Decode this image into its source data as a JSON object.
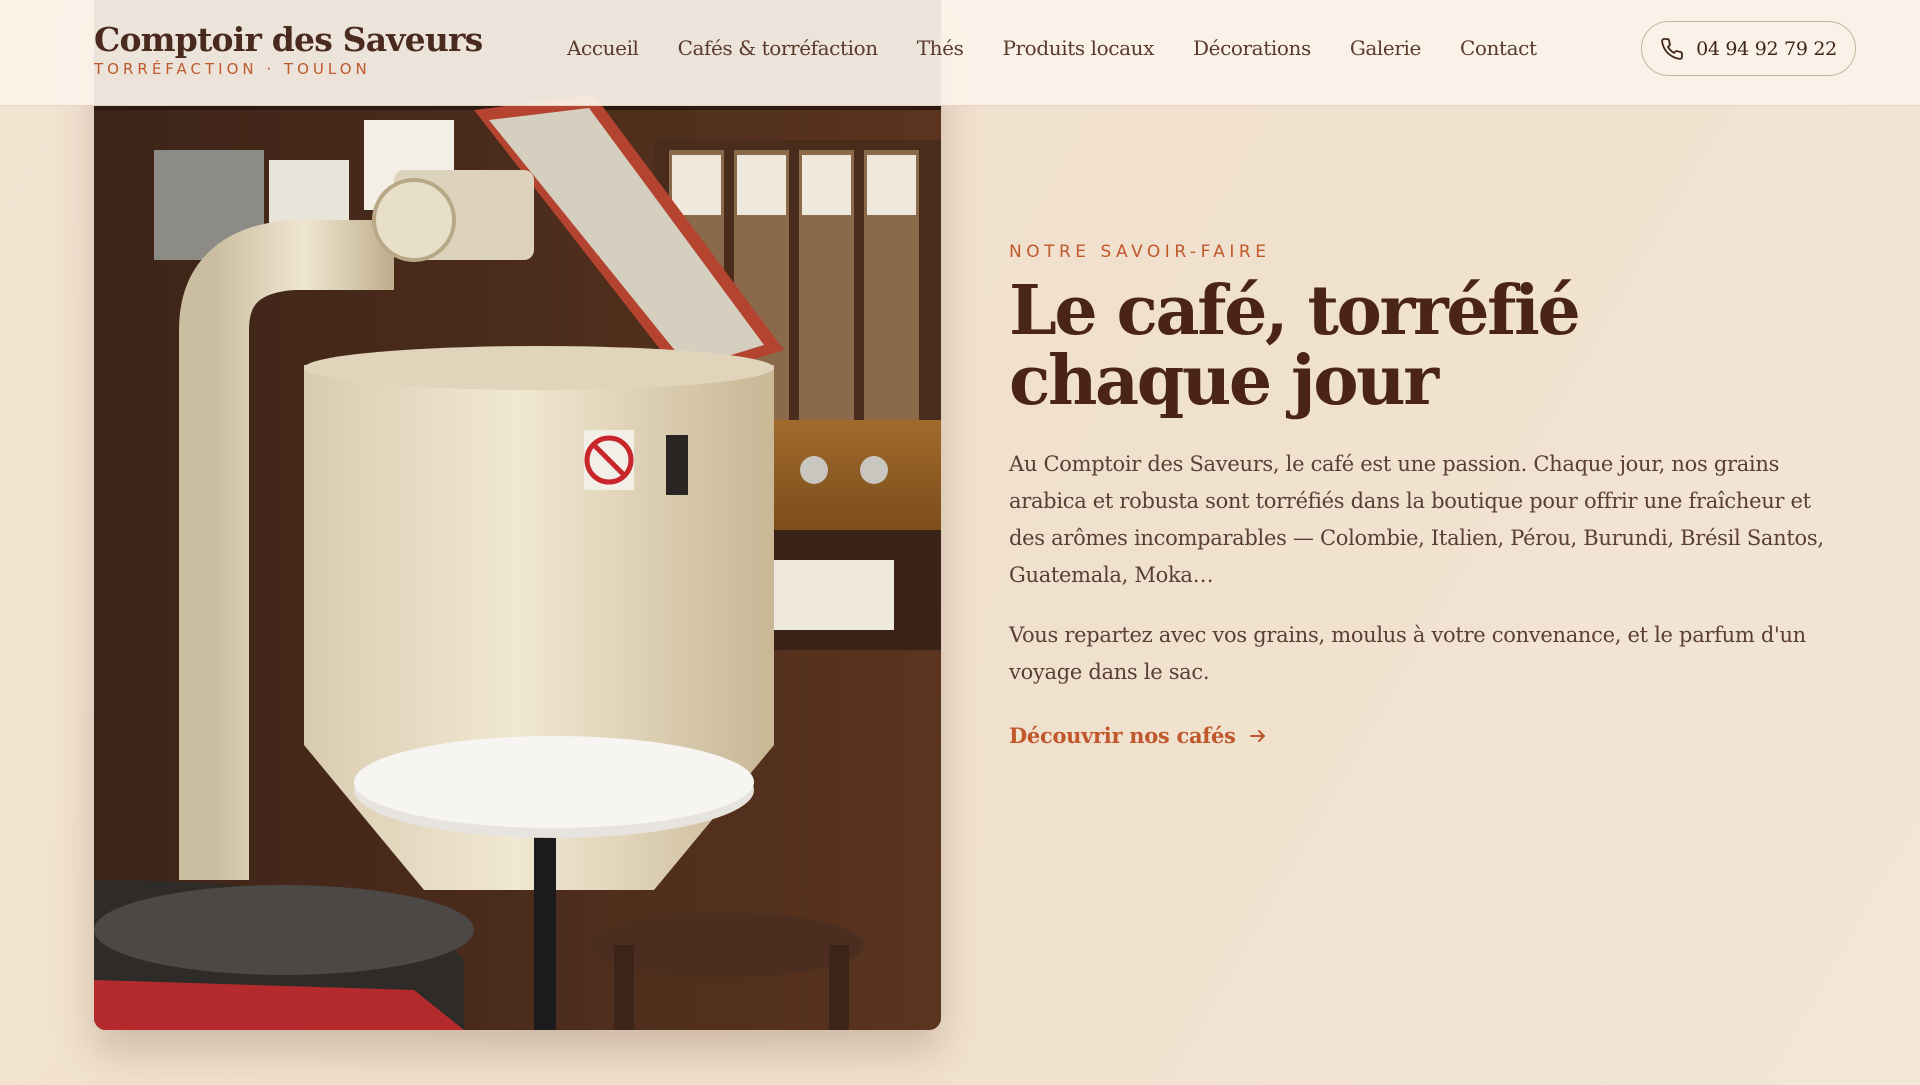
{
  "header": {
    "brand_name": "Comptoir des Saveurs",
    "brand_tagline": "TORRÉFACTION · TOULON",
    "nav": [
      {
        "label": "Accueil"
      },
      {
        "label": "Cafés & torréfaction"
      },
      {
        "label": "Thés"
      },
      {
        "label": "Produits locaux"
      },
      {
        "label": "Décorations"
      },
      {
        "label": "Galerie"
      },
      {
        "label": "Contact"
      }
    ],
    "phone": "04 94 92 79 22",
    "phone_icon": "phone-icon"
  },
  "hero": {
    "photo_icon": "coffee-roaster-photo",
    "eyebrow": "NOTRE SAVOIR-FAIRE",
    "title": "Le café, torréfié chaque jour",
    "paragraph_1": "Au Comptoir des Saveurs, le café est une passion. Chaque jour, nos grains arabica et robusta sont torréfiés dans la boutique pour offrir une fraîcheur et des arômes incomparables — Colombie, Italien, Pérou, Burundi, Brésil Santos, Guatemala, Moka…",
    "paragraph_2": "Vous repartez avec vos grains, moulus à votre convenance, et le parfum d'un voyage dans le sac.",
    "cta_label": "Découvrir nos cafés",
    "cta_icon": "arrow-right-icon"
  },
  "colors": {
    "accent": "#c0582b",
    "heading": "#4a2418",
    "background": "#f2e3d1"
  }
}
